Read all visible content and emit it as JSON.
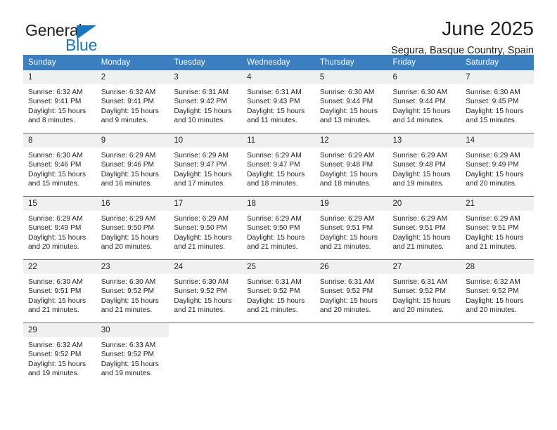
{
  "brand": {
    "name_part1": "General",
    "name_part2": "Blue",
    "triangle_color": "#1b75bb",
    "text_color": "#231f20"
  },
  "header": {
    "title": "June 2025",
    "subtitle": "Segura, Basque Country, Spain"
  },
  "theme": {
    "header_bar_color": "#3c7fc1",
    "daynum_bg": "#f0f0f0",
    "row_divider_color": "#3c7fc1",
    "text_color": "#231f20"
  },
  "weekday_headers": [
    "Sunday",
    "Monday",
    "Tuesday",
    "Wednesday",
    "Thursday",
    "Friday",
    "Saturday"
  ],
  "weeks": [
    [
      {
        "day": "1",
        "sunrise": "Sunrise: 6:32 AM",
        "sunset": "Sunset: 9:41 PM",
        "daylight": "Daylight: 15 hours and 8 minutes."
      },
      {
        "day": "2",
        "sunrise": "Sunrise: 6:32 AM",
        "sunset": "Sunset: 9:41 PM",
        "daylight": "Daylight: 15 hours and 9 minutes."
      },
      {
        "day": "3",
        "sunrise": "Sunrise: 6:31 AM",
        "sunset": "Sunset: 9:42 PM",
        "daylight": "Daylight: 15 hours and 10 minutes."
      },
      {
        "day": "4",
        "sunrise": "Sunrise: 6:31 AM",
        "sunset": "Sunset: 9:43 PM",
        "daylight": "Daylight: 15 hours and 11 minutes."
      },
      {
        "day": "5",
        "sunrise": "Sunrise: 6:30 AM",
        "sunset": "Sunset: 9:44 PM",
        "daylight": "Daylight: 15 hours and 13 minutes."
      },
      {
        "day": "6",
        "sunrise": "Sunrise: 6:30 AM",
        "sunset": "Sunset: 9:44 PM",
        "daylight": "Daylight: 15 hours and 14 minutes."
      },
      {
        "day": "7",
        "sunrise": "Sunrise: 6:30 AM",
        "sunset": "Sunset: 9:45 PM",
        "daylight": "Daylight: 15 hours and 15 minutes."
      }
    ],
    [
      {
        "day": "8",
        "sunrise": "Sunrise: 6:30 AM",
        "sunset": "Sunset: 9:46 PM",
        "daylight": "Daylight: 15 hours and 15 minutes."
      },
      {
        "day": "9",
        "sunrise": "Sunrise: 6:29 AM",
        "sunset": "Sunset: 9:46 PM",
        "daylight": "Daylight: 15 hours and 16 minutes."
      },
      {
        "day": "10",
        "sunrise": "Sunrise: 6:29 AM",
        "sunset": "Sunset: 9:47 PM",
        "daylight": "Daylight: 15 hours and 17 minutes."
      },
      {
        "day": "11",
        "sunrise": "Sunrise: 6:29 AM",
        "sunset": "Sunset: 9:47 PM",
        "daylight": "Daylight: 15 hours and 18 minutes."
      },
      {
        "day": "12",
        "sunrise": "Sunrise: 6:29 AM",
        "sunset": "Sunset: 9:48 PM",
        "daylight": "Daylight: 15 hours and 18 minutes."
      },
      {
        "day": "13",
        "sunrise": "Sunrise: 6:29 AM",
        "sunset": "Sunset: 9:48 PM",
        "daylight": "Daylight: 15 hours and 19 minutes."
      },
      {
        "day": "14",
        "sunrise": "Sunrise: 6:29 AM",
        "sunset": "Sunset: 9:49 PM",
        "daylight": "Daylight: 15 hours and 20 minutes."
      }
    ],
    [
      {
        "day": "15",
        "sunrise": "Sunrise: 6:29 AM",
        "sunset": "Sunset: 9:49 PM",
        "daylight": "Daylight: 15 hours and 20 minutes."
      },
      {
        "day": "16",
        "sunrise": "Sunrise: 6:29 AM",
        "sunset": "Sunset: 9:50 PM",
        "daylight": "Daylight: 15 hours and 20 minutes."
      },
      {
        "day": "17",
        "sunrise": "Sunrise: 6:29 AM",
        "sunset": "Sunset: 9:50 PM",
        "daylight": "Daylight: 15 hours and 21 minutes."
      },
      {
        "day": "18",
        "sunrise": "Sunrise: 6:29 AM",
        "sunset": "Sunset: 9:50 PM",
        "daylight": "Daylight: 15 hours and 21 minutes."
      },
      {
        "day": "19",
        "sunrise": "Sunrise: 6:29 AM",
        "sunset": "Sunset: 9:51 PM",
        "daylight": "Daylight: 15 hours and 21 minutes."
      },
      {
        "day": "20",
        "sunrise": "Sunrise: 6:29 AM",
        "sunset": "Sunset: 9:51 PM",
        "daylight": "Daylight: 15 hours and 21 minutes."
      },
      {
        "day": "21",
        "sunrise": "Sunrise: 6:29 AM",
        "sunset": "Sunset: 9:51 PM",
        "daylight": "Daylight: 15 hours and 21 minutes."
      }
    ],
    [
      {
        "day": "22",
        "sunrise": "Sunrise: 6:30 AM",
        "sunset": "Sunset: 9:51 PM",
        "daylight": "Daylight: 15 hours and 21 minutes."
      },
      {
        "day": "23",
        "sunrise": "Sunrise: 6:30 AM",
        "sunset": "Sunset: 9:52 PM",
        "daylight": "Daylight: 15 hours and 21 minutes."
      },
      {
        "day": "24",
        "sunrise": "Sunrise: 6:30 AM",
        "sunset": "Sunset: 9:52 PM",
        "daylight": "Daylight: 15 hours and 21 minutes."
      },
      {
        "day": "25",
        "sunrise": "Sunrise: 6:31 AM",
        "sunset": "Sunset: 9:52 PM",
        "daylight": "Daylight: 15 hours and 21 minutes."
      },
      {
        "day": "26",
        "sunrise": "Sunrise: 6:31 AM",
        "sunset": "Sunset: 9:52 PM",
        "daylight": "Daylight: 15 hours and 20 minutes."
      },
      {
        "day": "27",
        "sunrise": "Sunrise: 6:31 AM",
        "sunset": "Sunset: 9:52 PM",
        "daylight": "Daylight: 15 hours and 20 minutes."
      },
      {
        "day": "28",
        "sunrise": "Sunrise: 6:32 AM",
        "sunset": "Sunset: 9:52 PM",
        "daylight": "Daylight: 15 hours and 20 minutes."
      }
    ],
    [
      {
        "day": "29",
        "sunrise": "Sunrise: 6:32 AM",
        "sunset": "Sunset: 9:52 PM",
        "daylight": "Daylight: 15 hours and 19 minutes."
      },
      {
        "day": "30",
        "sunrise": "Sunrise: 6:33 AM",
        "sunset": "Sunset: 9:52 PM",
        "daylight": "Daylight: 15 hours and 19 minutes."
      },
      {
        "day": "",
        "sunrise": "",
        "sunset": "",
        "daylight": ""
      },
      {
        "day": "",
        "sunrise": "",
        "sunset": "",
        "daylight": ""
      },
      {
        "day": "",
        "sunrise": "",
        "sunset": "",
        "daylight": ""
      },
      {
        "day": "",
        "sunrise": "",
        "sunset": "",
        "daylight": ""
      },
      {
        "day": "",
        "sunrise": "",
        "sunset": "",
        "daylight": ""
      }
    ]
  ]
}
